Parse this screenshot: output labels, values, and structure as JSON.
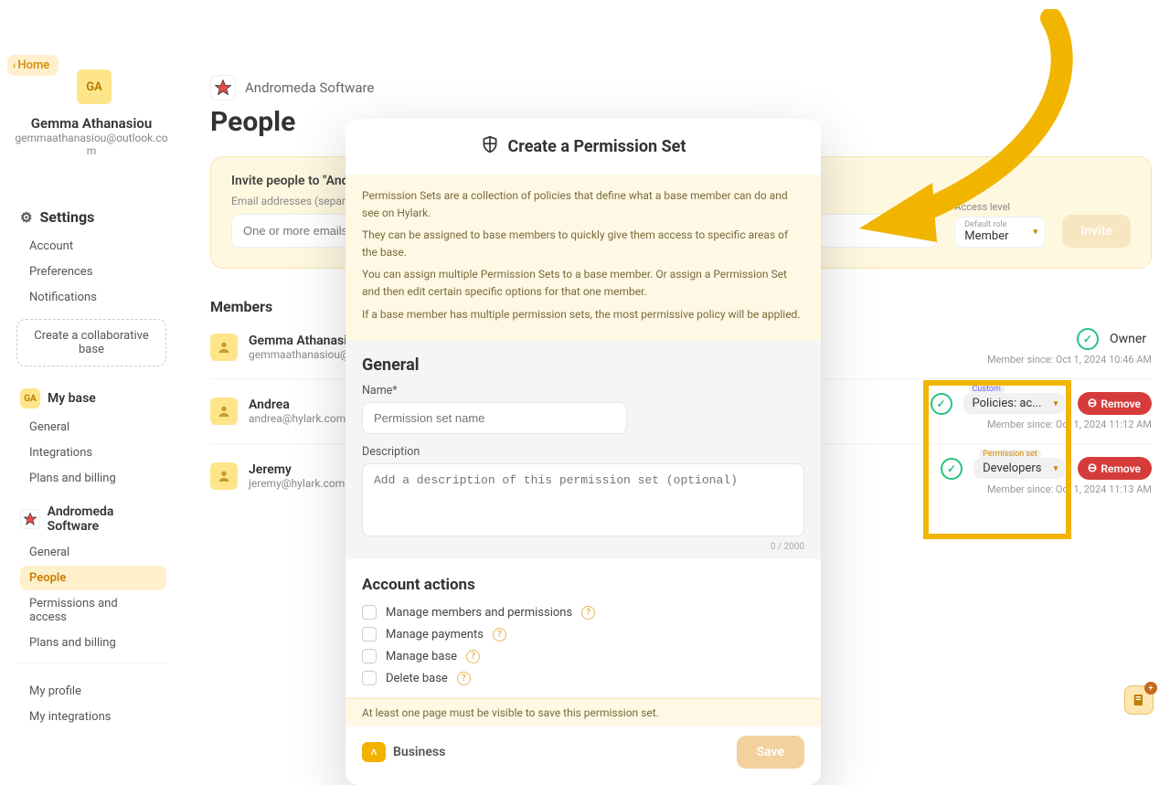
{
  "home_label": "Home",
  "user": {
    "initials": "GA",
    "name": "Gemma Athanasiou",
    "email": "gemmaathanasiou@outlook.com"
  },
  "settings_label": "Settings",
  "settings_items": [
    "Account",
    "Preferences",
    "Notifications"
  ],
  "create_base": "Create a collaborative base",
  "mybase": {
    "title": "My base",
    "items": [
      "General",
      "Integrations",
      "Plans and billing"
    ]
  },
  "org": {
    "title": "Andromeda Software",
    "items": [
      "General",
      "People",
      "Permissions and access",
      "Plans and billing"
    ],
    "active": "People"
  },
  "profile_items": [
    "My profile",
    "My integrations"
  ],
  "page": {
    "org_name": "Andromeda Software",
    "title": "People"
  },
  "invite": {
    "heading": "Invite people to \"Andromeda Software\"",
    "email_label": "Email addresses (separated by comma)",
    "email_placeholder": "One or more emails",
    "access_label": "Access level",
    "default_role_label": "Default role",
    "default_role": "Member",
    "invite_btn": "Invite"
  },
  "members_label": "Members",
  "members": [
    {
      "name": "Gemma Athanasiou",
      "email": "gemmaathanasiou@outlook.com",
      "role": "Owner",
      "since_label": "Member since:",
      "since": "Oct 1, 2024 10:46 AM"
    },
    {
      "name": "Andrea",
      "email": "andrea@hylark.com",
      "role_tag": "Custom",
      "role": "Policies: ac...",
      "remove": "Remove",
      "since_label": "Member since:",
      "since": "Oct 1, 2024 11:12 AM"
    },
    {
      "name": "Jeremy",
      "email": "jeremy@hylark.com",
      "role_tag": "Permission set",
      "role": "Developers",
      "remove": "Remove",
      "since_label": "Member since:",
      "since": "Oct 1, 2024 11:13 AM"
    }
  ],
  "modal": {
    "title": "Create a Permission Set",
    "desc": [
      "Permission Sets are a collection of policies that define what a base member can do and see on Hylark.",
      "They can be assigned to base members to quickly give them access to specific areas of the base.",
      "You can assign multiple Permission Sets to a base member. Or assign a Permission Set and then edit certain specific options for that one member.",
      "If a base member has multiple permission sets, the most permissive policy will be applied."
    ],
    "general_label": "General",
    "name_label": "Name*",
    "name_placeholder": "Permission set name",
    "desc_label": "Description",
    "desc_placeholder": "Add a description of this permission set (optional)",
    "char_count": "0 / 2000",
    "actions_label": "Account actions",
    "actions": [
      "Manage members and permissions",
      "Manage payments",
      "Manage base",
      "Delete base"
    ],
    "warning": "At least one page must be visible to save this permission set.",
    "collapse": "Business",
    "save": "Save"
  }
}
